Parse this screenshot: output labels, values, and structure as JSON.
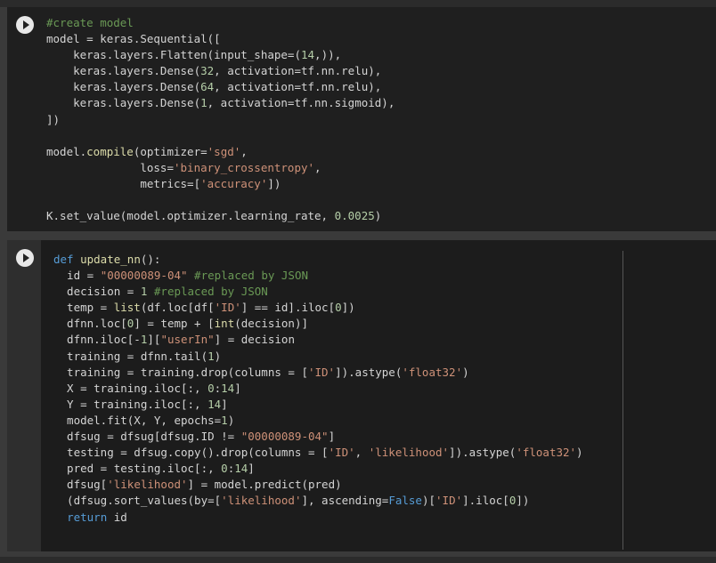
{
  "cells": [
    {
      "type": "code",
      "run_label": "Run cell",
      "lines": [
        [
          [
            "#create model",
            "c"
          ]
        ],
        [
          [
            "model = keras.Sequential([",
            ""
          ]
        ],
        [
          [
            "    keras.layers.Flatten(input_shape=(",
            ""
          ],
          [
            "14",
            "n"
          ],
          [
            ",)),",
            ""
          ]
        ],
        [
          [
            "    keras.layers.Dense(",
            ""
          ],
          [
            "32",
            "n"
          ],
          [
            ", activation=tf.nn.relu),",
            ""
          ]
        ],
        [
          [
            "    keras.layers.Dense(",
            ""
          ],
          [
            "64",
            "n"
          ],
          [
            ", activation=tf.nn.relu),",
            ""
          ]
        ],
        [
          [
            "    keras.layers.Dense(",
            ""
          ],
          [
            "1",
            "n"
          ],
          [
            ", activation=tf.nn.sigmoid),",
            ""
          ]
        ],
        [
          [
            "])",
            ""
          ]
        ],
        [],
        [
          [
            "model.",
            ""
          ],
          [
            "compile",
            "f"
          ],
          [
            "(optimizer=",
            ""
          ],
          [
            "'sgd'",
            "s"
          ],
          [
            ",",
            ""
          ]
        ],
        [
          [
            "              loss=",
            ""
          ],
          [
            "'binary_crossentropy'",
            "s"
          ],
          [
            ",",
            ""
          ]
        ],
        [
          [
            "              metrics=[",
            ""
          ],
          [
            "'accuracy'",
            "s"
          ],
          [
            "])",
            ""
          ]
        ],
        [],
        [
          [
            "K.set_value(model.optimizer.learning_rate, ",
            ""
          ],
          [
            "0.0025",
            "n"
          ],
          [
            ")",
            ""
          ]
        ]
      ]
    },
    {
      "type": "code",
      "run_label": "Run cell",
      "lines": [
        [
          [
            "def ",
            "k"
          ],
          [
            "update_nn",
            "f"
          ],
          [
            "():",
            ""
          ]
        ],
        [
          [
            "  id = ",
            ""
          ],
          [
            "\"00000089-04\"",
            "s"
          ],
          [
            " #replaced by JSON",
            "c"
          ]
        ],
        [
          [
            "  decision = ",
            ""
          ],
          [
            "1",
            "n"
          ],
          [
            " #replaced by JSON",
            "c"
          ]
        ],
        [
          [
            "  temp = ",
            ""
          ],
          [
            "list",
            "f"
          ],
          [
            "(df.loc[df[",
            ""
          ],
          [
            "'ID'",
            "s"
          ],
          [
            "] == id].iloc[",
            ""
          ],
          [
            "0",
            "n"
          ],
          [
            "])",
            ""
          ]
        ],
        [
          [
            "  dfnn.loc[",
            ""
          ],
          [
            "0",
            "n"
          ],
          [
            "] = temp + [",
            ""
          ],
          [
            "int",
            "f"
          ],
          [
            "(decision)]",
            ""
          ]
        ],
        [
          [
            "  dfnn.iloc[-",
            ""
          ],
          [
            "1",
            "n"
          ],
          [
            "][",
            ""
          ],
          [
            "\"userIn\"",
            "s"
          ],
          [
            "] = decision",
            ""
          ]
        ],
        [
          [
            "  training = dfnn.tail(",
            ""
          ],
          [
            "1",
            "n"
          ],
          [
            ")",
            ""
          ]
        ],
        [
          [
            "  training = training.drop(columns = [",
            ""
          ],
          [
            "'ID'",
            "s"
          ],
          [
            "]).astype(",
            ""
          ],
          [
            "'float32'",
            "s"
          ],
          [
            ")",
            ""
          ]
        ],
        [
          [
            "  X = training.iloc[:, ",
            ""
          ],
          [
            "0",
            "n"
          ],
          [
            ":",
            ""
          ],
          [
            "14",
            "n"
          ],
          [
            "]",
            ""
          ]
        ],
        [
          [
            "  Y = training.iloc[:, ",
            ""
          ],
          [
            "14",
            "n"
          ],
          [
            "]",
            ""
          ]
        ],
        [
          [
            "  model.fit(X, Y, epochs=",
            ""
          ],
          [
            "1",
            "n"
          ],
          [
            ")",
            ""
          ]
        ],
        [
          [
            "  dfsug = dfsug[dfsug.ID != ",
            ""
          ],
          [
            "\"00000089-04\"",
            "s"
          ],
          [
            "]",
            ""
          ]
        ],
        [
          [
            "  testing = dfsug.copy().drop(columns = [",
            ""
          ],
          [
            "'ID'",
            "s"
          ],
          [
            ", ",
            ""
          ],
          [
            "'likelihood'",
            "s"
          ],
          [
            "]).astype(",
            ""
          ],
          [
            "'float32'",
            "s"
          ],
          [
            ")",
            ""
          ]
        ],
        [
          [
            "  pred = testing.iloc[:, ",
            ""
          ],
          [
            "0",
            "n"
          ],
          [
            ":",
            ""
          ],
          [
            "14",
            "n"
          ],
          [
            "]",
            ""
          ]
        ],
        [
          [
            "  dfsug[",
            ""
          ],
          [
            "'likelihood'",
            "s"
          ],
          [
            "] = model.predict(pred)",
            ""
          ]
        ],
        [
          [
            "  (dfsug.sort_values(by=[",
            ""
          ],
          [
            "'likelihood'",
            "s"
          ],
          [
            "], ascending=",
            ""
          ],
          [
            "False",
            "k"
          ],
          [
            ")[",
            ""
          ],
          [
            "'ID'",
            "s"
          ],
          [
            "].iloc[",
            ""
          ],
          [
            "0",
            "n"
          ],
          [
            "])",
            ""
          ]
        ],
        [
          [
            "  ",
            ""
          ],
          [
            "return",
            "k"
          ],
          [
            " id",
            ""
          ]
        ]
      ]
    }
  ]
}
